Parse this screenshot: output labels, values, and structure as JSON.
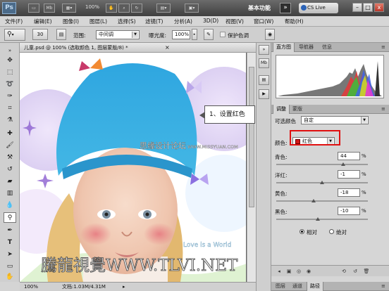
{
  "titlebar": {
    "app_logo": "Ps",
    "mb_label": "Mb",
    "zoom_display": "100%",
    "workspace": "基本功能",
    "workspace_arrow": "»",
    "cs_live": "CS Live",
    "minimize": "–",
    "restore": "□",
    "close": "x"
  },
  "menu": [
    "文件(F)",
    "编辑(E)",
    "图像(I)",
    "图层(L)",
    "选择(S)",
    "滤镜(T)",
    "分析(A)",
    "3D(D)",
    "视图(V)",
    "窗口(W)",
    "帮助(H)"
  ],
  "options": {
    "brush_size": "30",
    "range_label": "范围:",
    "range_value": "中间调",
    "exposure_label": "曝光度:",
    "exposure_value": "100%",
    "protect_tones": "保护色调"
  },
  "document": {
    "tab_title": "儿童.psd @ 100% (选取颜色 1, 图层蒙版/8) *",
    "tab_close": "×",
    "status_zoom": "100%",
    "status_doc": "文档:1.03M/4.31M",
    "watermark_top": "思缘设计论坛",
    "watermark_url": "WWW.MISSYUAN.COM",
    "watermark_bottom": "騰龍視覺WWW.TLVI.NET",
    "photo_text": "Love is a World"
  },
  "callout": "1、设置红色",
  "panels": {
    "top_tabs": [
      "直方图",
      "导航器",
      "信息"
    ],
    "mid_tabs": [
      "调整",
      "蒙版"
    ],
    "bottom_tabs": [
      "图层",
      "通道",
      "路径"
    ],
    "selective_label": "可选颜色",
    "preset_value": "自定",
    "colors_label": "颜色:",
    "colors_value": "红色",
    "cyan_label": "青色:",
    "cyan_value": "44",
    "magenta_label": "洋红:",
    "magenta_value": "-1",
    "yellow_label": "黄色:",
    "yellow_value": "-18",
    "black_label": "黑色:",
    "black_value": "-10",
    "pct": "%",
    "relative": "相对",
    "absolute": "绝对"
  },
  "colors": {
    "hat": "#37a8dc",
    "highlight": "#e01010",
    "selected_swatch": "#d21a1a"
  }
}
